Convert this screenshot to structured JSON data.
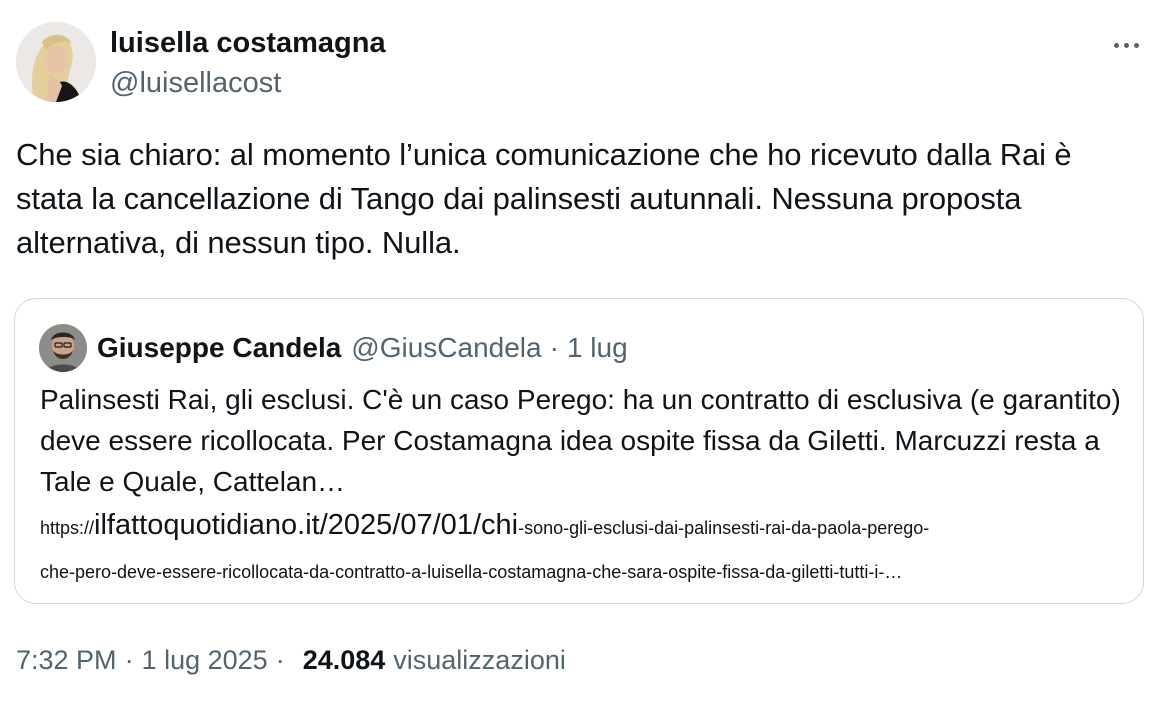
{
  "author": {
    "name": "luisella costamagna",
    "handle": "@luisellacost"
  },
  "tweet_text": "Che sia chiaro: al momento l’unica comunicazione che ho ricevuto dalla Rai è stata la cancellazione di Tango dai palinsesti autunnali. Nessuna proposta alternativa, di nessun tipo. Nulla.",
  "quote": {
    "name": "Giuseppe Candela",
    "handle": "@GiusCandela",
    "separator": "·",
    "date": "1 lug",
    "text": "Palinsesti Rai, gli esclusi. C'è un caso Perego: ha un contratto di esclusiva (e garantito) deve essere ricollocata. Per Costamagna idea ospite fissa da Giletti. Marcuzzi resta a Tale e Quale, Cattelan…",
    "link": {
      "scheme": "https://",
      "domain_path": "ilfattoquotidiano.it/2025/07/01/chi",
      "tail_line1": "-sono-gli-esclusi-dai-palinsesti-rai-da-paola-perego-",
      "tail_line2": "che-pero-deve-essere-ricollocata-da-contratto-a-luisella-costamagna-che-sara-ospite-fissa-da-giletti-tutti-i-…"
    }
  },
  "meta": {
    "time": "7:32 PM",
    "date": "1 lug 2025",
    "separator": "·",
    "views": "24.084",
    "views_label": "visualizzazioni"
  },
  "icons": {
    "more": "more-horizontal-icon"
  }
}
